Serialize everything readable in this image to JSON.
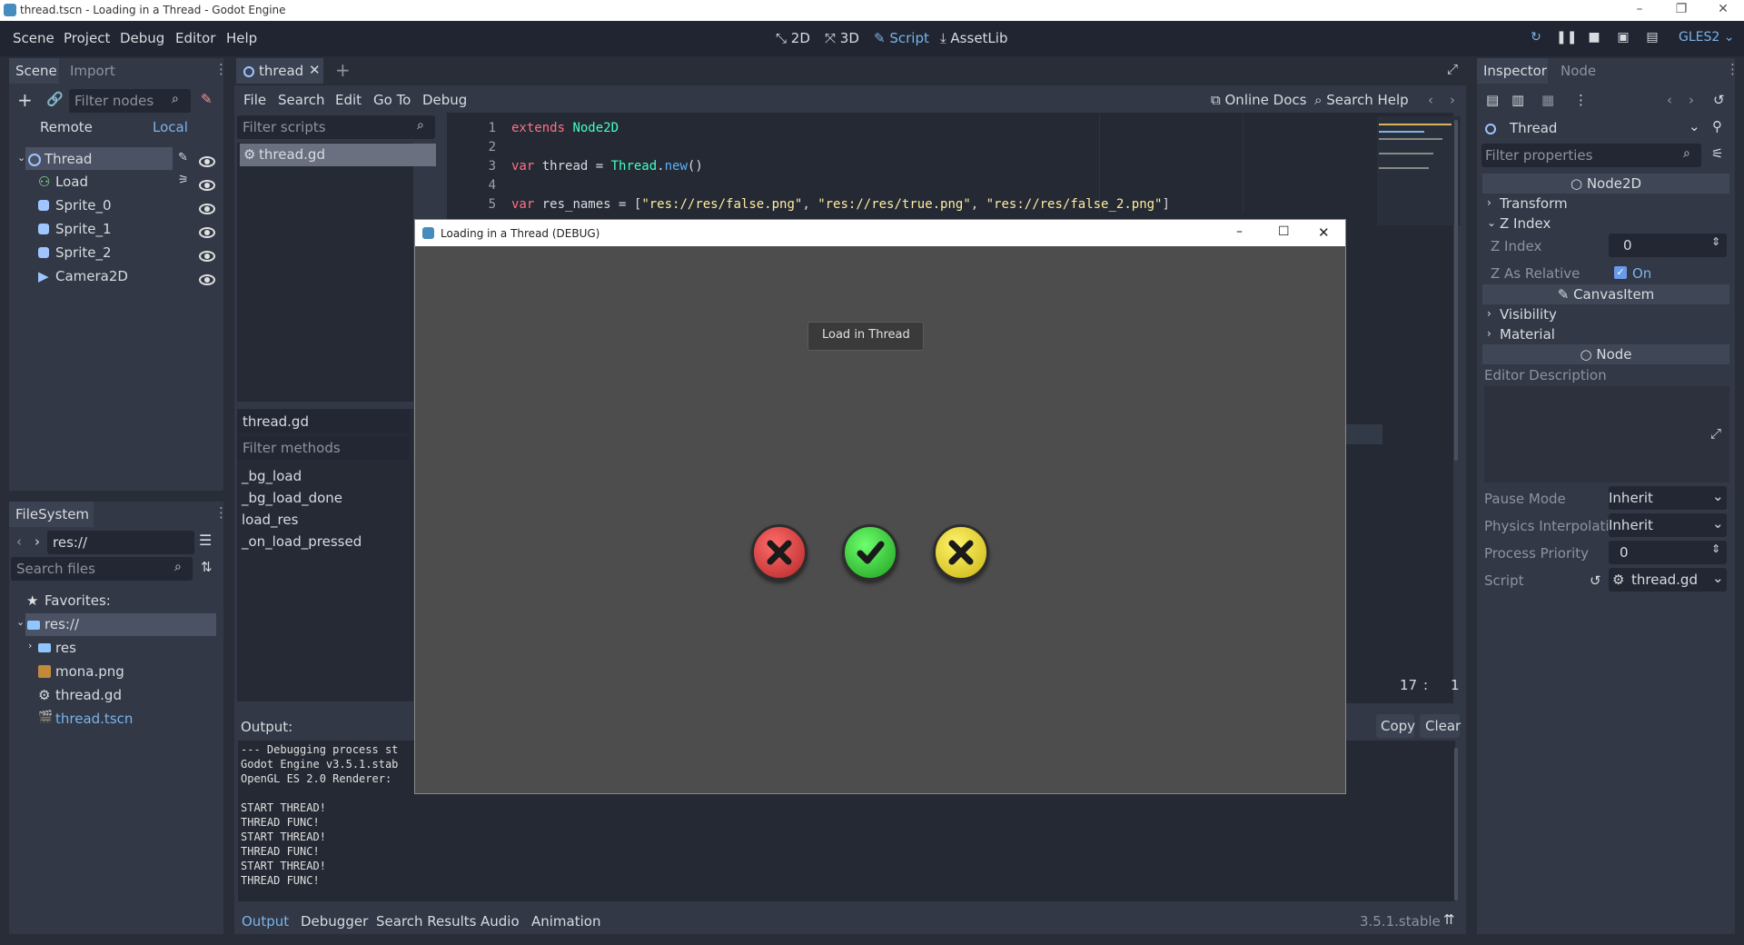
{
  "window": {
    "title": "thread.tscn - Loading in a Thread - Godot Engine",
    "minimize": "–",
    "maximize": "❐",
    "close": "✕"
  },
  "menu": [
    "Scene",
    "Project",
    "Debug",
    "Editor",
    "Help"
  ],
  "modes": [
    {
      "icon": "2d-icon",
      "label": "2D",
      "active": false
    },
    {
      "icon": "3d-icon",
      "label": "3D",
      "active": false
    },
    {
      "icon": "script-icon",
      "label": "Script",
      "active": true
    },
    {
      "icon": "assetlib-icon",
      "label": "AssetLib",
      "active": false
    }
  ],
  "renderer": "GLES2",
  "scene_dock": {
    "tabs": [
      "Scene",
      "Import"
    ],
    "filter_placeholder": "Filter nodes",
    "remote": "Remote",
    "local": "Local",
    "nodes": [
      {
        "name": "Thread",
        "icon": "node2d-icon",
        "selected": true
      },
      {
        "name": "Load",
        "icon": "button-icon"
      },
      {
        "name": "Sprite_0",
        "icon": "sprite-icon"
      },
      {
        "name": "Sprite_1",
        "icon": "sprite-icon"
      },
      {
        "name": "Sprite_2",
        "icon": "sprite-icon"
      },
      {
        "name": "Camera2D",
        "icon": "camera-icon"
      }
    ]
  },
  "filesystem": {
    "title": "FileSystem",
    "path": "res://",
    "search_placeholder": "Search files",
    "favorites": "Favorites:",
    "items": [
      {
        "name": "res://",
        "icon": "folder-icon",
        "selected": true
      },
      {
        "name": "res",
        "icon": "folder-icon"
      },
      {
        "name": "mona.png",
        "icon": "image-icon"
      },
      {
        "name": "thread.gd",
        "icon": "gear-icon"
      },
      {
        "name": "thread.tscn",
        "icon": "scene-icon",
        "highlight": true
      }
    ]
  },
  "script_editor": {
    "tab": "thread",
    "menu": [
      "File",
      "Search",
      "Edit",
      "Go To",
      "Debug"
    ],
    "online_docs": "Online Docs",
    "search_help": "Search Help",
    "filter_scripts": "Filter scripts",
    "scripts": [
      "thread.gd"
    ],
    "current_script": "thread.gd",
    "filter_methods": "Filter methods",
    "methods": [
      "_bg_load",
      "_bg_load_done",
      "load_res",
      "_on_load_pressed"
    ],
    "line_numbers": [
      "1",
      "2",
      "3",
      "4",
      "5"
    ],
    "line1": {
      "kw": "extends",
      "ty": "Node2D"
    },
    "line3": {
      "kw": "var",
      "plain": " thread = ",
      "ty": "Thread",
      "dot": ".",
      "fn": "new",
      "rest": "()"
    },
    "line5": {
      "kw": "var",
      "plain": " res_names = [",
      "s1": "\"res://res/false.png\"",
      "c1": ", ",
      "s2": "\"res://res/true.png\"",
      "c2": ", ",
      "s3": "\"res://res/false_2.png\"",
      "end": "]"
    },
    "cursor_line": "17",
    "cursor_sep": ":",
    "cursor_col": "1"
  },
  "output": {
    "label": "Output:",
    "copy": "Copy",
    "clear": "Clear",
    "lines": "--- Debugging process st\nGodot Engine v3.5.1.stab\nOpenGL ES 2.0 Renderer:\n\nSTART THREAD!\nTHREAD FUNC!\nSTART THREAD!\nTHREAD FUNC!\nSTART THREAD!\nTHREAD FUNC!"
  },
  "bottom_tabs": [
    "Output",
    "Debugger",
    "Search Results",
    "Audio",
    "Animation"
  ],
  "version": "3.5.1.stable",
  "debug_window": {
    "title": "Loading in a Thread (DEBUG)",
    "button": "Load in Thread",
    "balls": [
      {
        "kind": "false",
        "color": "#c83a3a"
      },
      {
        "kind": "true",
        "color": "#2fbf2f"
      },
      {
        "kind": "false_2",
        "color": "#e6d21c"
      }
    ]
  },
  "inspector": {
    "tabs": [
      "Inspector",
      "Node"
    ],
    "object": "Thread",
    "filter_placeholder": "Filter properties",
    "sec_node2d": "Node2D",
    "transform": "Transform",
    "zindex_group": "Z Index",
    "zindex_label": "Z Index",
    "zindex_value": "0",
    "zrel_label": "Z As Relative",
    "zrel_value": "On",
    "sec_canvasitem": "CanvasItem",
    "visibility": "Visibility",
    "material": "Material",
    "sec_node": "Node",
    "editor_desc": "Editor Description",
    "pause_label": "Pause Mode",
    "pause_value": "Inherit",
    "phys_label": "Physics Interpolati",
    "phys_value": "Inherit",
    "priority_label": "Process Priority",
    "priority_value": "0",
    "script_label": "Script",
    "script_value": "thread.gd"
  }
}
